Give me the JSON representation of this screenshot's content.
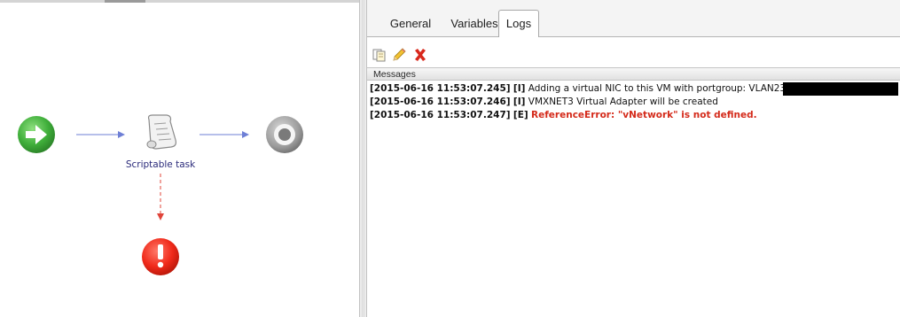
{
  "schema": {
    "task_label": "Scriptable task",
    "nodes": {
      "start_icon": "start-arrow-icon",
      "task_icon": "scroll-icon",
      "end_icon": "end-target-icon",
      "error_icon": "exception-icon"
    },
    "colors": {
      "flow_arrow": "#6e7fd6",
      "error_arrow": "#e0443a",
      "task_label": "#2a2a7a"
    }
  },
  "properties": {
    "tabs": [
      {
        "label": "General",
        "active": false
      },
      {
        "label": "Variables",
        "active": false
      },
      {
        "label": "Logs",
        "active": true
      }
    ],
    "toolbar": {
      "copy_icon": "copy-icon",
      "edit_icon": "pencil-icon",
      "delete_icon": "delete-x-icon"
    },
    "messages": {
      "header": "Messages",
      "rows": [
        {
          "timestamp": "[2015-06-16 11:53:07.245]",
          "level": "[I]",
          "text": "Adding a virtual NIC to this VM with portgroup: VLAN23",
          "redacted": true
        },
        {
          "timestamp": "[2015-06-16 11:53:07.246]",
          "level": "[I]",
          "text": "VMXNET3 Virtual Adapter will be created",
          "redacted": false
        },
        {
          "timestamp": "[2015-06-16 11:53:07.247]",
          "level": "[E]",
          "text": "ReferenceError: \"vNetwork\" is not defined.",
          "redacted": false,
          "error": true
        }
      ]
    }
  }
}
